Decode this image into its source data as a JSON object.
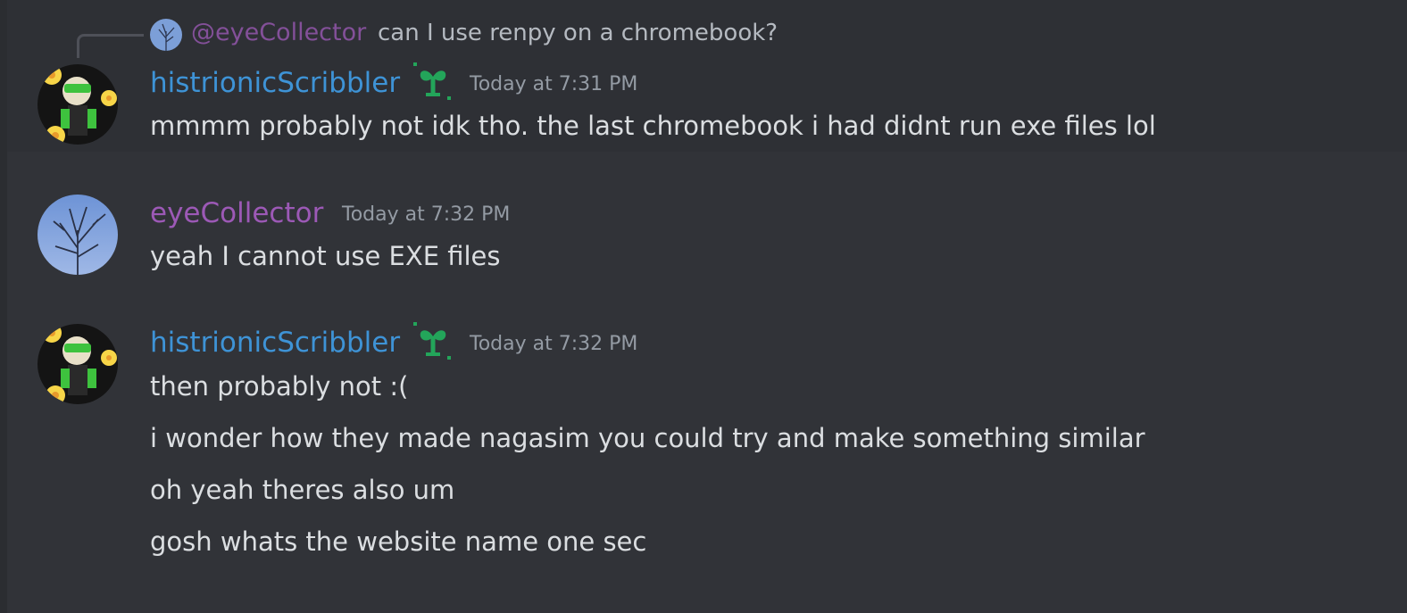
{
  "theme": {
    "background": "#313338",
    "hover_background": "#2e3035",
    "text": "#dbdee1",
    "muted": "#949ba4",
    "username_blue": "#3e93d6",
    "username_purple": "#9c59b6",
    "badge_green": "#23a55a"
  },
  "reply": {
    "mention": "@eyeCollector",
    "text": "can I use renpy on a chromebook?",
    "avatar_icon": "tree-sky-avatar"
  },
  "messages": [
    {
      "username": "histrionicScribbler",
      "badge_icon": "sprout-icon",
      "timestamp": "Today at 7:31 PM",
      "lines": [
        "mmmm probably not idk tho. the last chromebook i had didnt run exe files lol"
      ]
    },
    {
      "username": "eyeCollector",
      "timestamp": "Today at 7:32 PM",
      "lines": [
        "yeah I cannot use EXE files"
      ]
    },
    {
      "username": "histrionicScribbler",
      "badge_icon": "sprout-icon",
      "timestamp": "Today at 7:32 PM",
      "lines": [
        "then probably not :(",
        "i wonder how they made nagasim you could try and make something similar",
        "oh yeah theres also um",
        "gosh whats the website name one sec"
      ]
    }
  ]
}
